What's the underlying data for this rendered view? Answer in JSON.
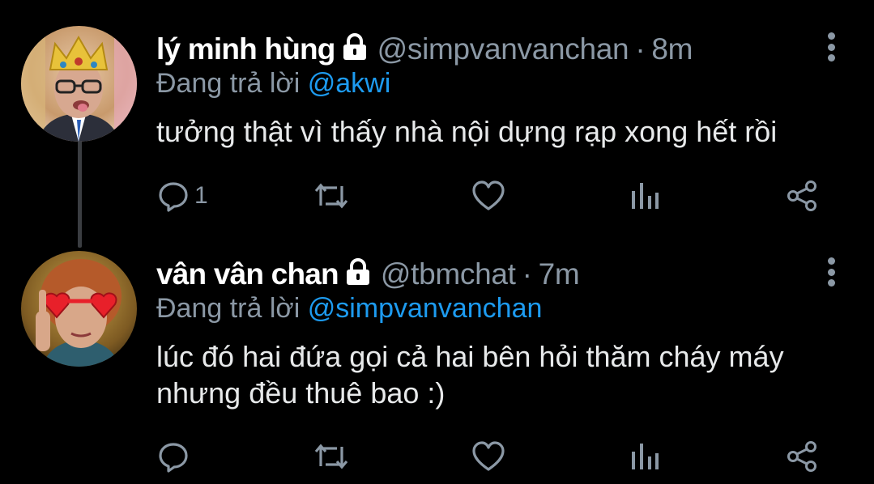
{
  "tweets": [
    {
      "display_name": "lý minh hùng",
      "handle": "@simpvanvanchan",
      "separator": "·",
      "time": "8m",
      "reply_prefix": "Đang trả lời",
      "reply_to": "@akwi",
      "text": "tưởng thật vì thấy nhà nội dựng rạp xong hết rồi",
      "reply_count": "1",
      "protected": true
    },
    {
      "display_name": "vân vân chan",
      "handle": "@tbmchat",
      "separator": "·",
      "time": "7m",
      "reply_prefix": "Đang trả lời",
      "reply_to": "@simpvanvanchan",
      "text": "lúc đó hai đứa gọi cả hai bên hỏi thăm cháy máy nhưng đều thuê bao :)",
      "reply_count": "",
      "protected": true
    }
  ],
  "icons": [
    "lock-icon",
    "more-icon",
    "reply-icon",
    "retweet-icon",
    "like-icon",
    "analytics-icon",
    "share-icon"
  ],
  "colors": {
    "background": "#000000",
    "accent": "#1d9bf0",
    "secondary_text": "#8b98a5",
    "primary_text": "#e7e9ea"
  }
}
